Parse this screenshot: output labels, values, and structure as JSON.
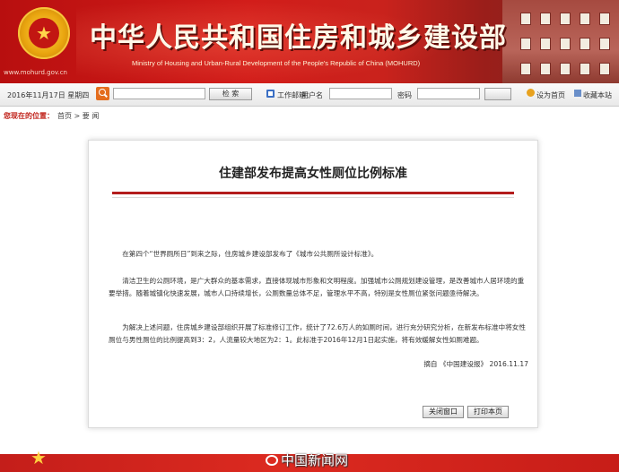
{
  "header": {
    "site_url": "www.mohurd.gov.cn",
    "title_cn": "中华人民共和国住房和城乡建设部",
    "title_en": "Ministry of Housing and Urban-Rural Development of the People's Republic of China (MOHURD)"
  },
  "toolbar": {
    "date": "2016年11月17日 星期四",
    "search_button": "检  索",
    "login_label": "工作邮箱：",
    "username_label": "用户名",
    "password_label": "密码",
    "set_home": "设为首页",
    "add_favorite": "收藏本站"
  },
  "breadcrumb": {
    "label": "您现在的位置：",
    "path": "首页 > 要    闻"
  },
  "article": {
    "title": "住建部发布提高女性厕位比例标准",
    "paragraphs": [
      "在第四个“世界厕所日”到来之际，住房城乡建设部发布了《城市公共厕所设计标准》。",
      "清洁卫生的公厕环境，是广大群众的基本需求，直接体现城市形象和文明程度。加强城市公厕规划建设管理，是改善城市人居环境的重要举措。随着城镇化快速发展，城市人口持续增长，公厕数量总体不足，管理水平不高，特别是女性厕位紧张问题亟待解决。",
      "为解决上述问题，住房城乡建设部组织开展了标准修订工作，统计了72.6万人的如厕时间，进行充分研究分析，在新发布标准中将女性厕位与男性厕位的比例提高到3：2，人流量较大地区为2：1。此标准于2016年12月1日起实施，将有效缓解女性如厕难题。"
    ],
    "signature": "摘自  《中国建设报》  2016.11.17"
  },
  "buttons": {
    "close": "关闭窗口",
    "print": "打印本页"
  },
  "watermark": "中国新闻网"
}
